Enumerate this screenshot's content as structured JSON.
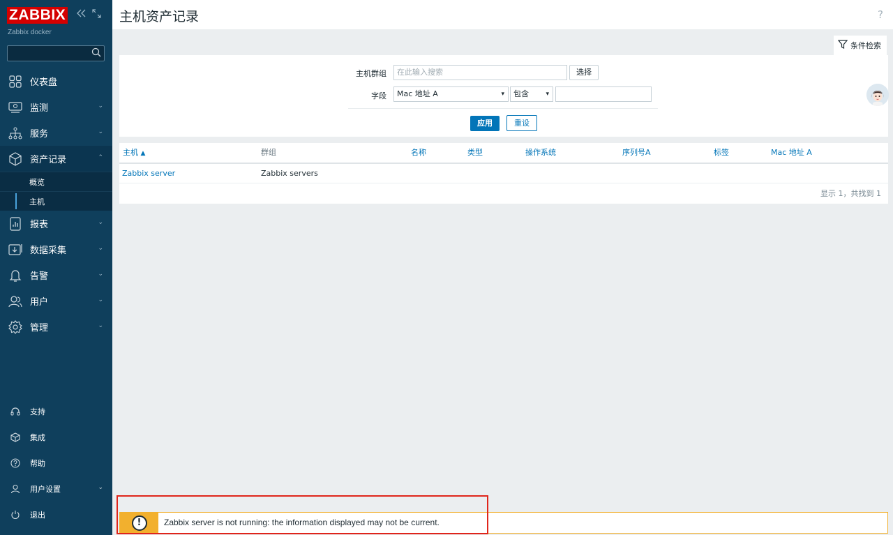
{
  "sidebar": {
    "logo": "ZABBIX",
    "subtitle": "Zabbix docker",
    "collapse_icon": "collapse-icon",
    "kiosk_icon": "kiosk-icon",
    "search_placeholder": "",
    "menu": [
      {
        "label": "仪表盘",
        "icon": "dashboard-icon",
        "expandable": false
      },
      {
        "label": "监测",
        "icon": "monitoring-icon",
        "expandable": true
      },
      {
        "label": "服务",
        "icon": "services-icon",
        "expandable": true
      },
      {
        "label": "资产记录",
        "icon": "inventory-icon",
        "expandable": true,
        "expanded": true
      },
      {
        "label": "报表",
        "icon": "reports-icon",
        "expandable": true
      },
      {
        "label": "数据采集",
        "icon": "data-collection-icon",
        "expandable": true
      },
      {
        "label": "告警",
        "icon": "alerts-icon",
        "expandable": true
      },
      {
        "label": "用户",
        "icon": "users-icon",
        "expandable": true
      },
      {
        "label": "管理",
        "icon": "administration-icon",
        "expandable": true
      }
    ],
    "submenu": [
      {
        "label": "概览",
        "selected": false
      },
      {
        "label": "主机",
        "selected": true
      }
    ],
    "bottom_menu": [
      {
        "label": "支持",
        "icon": "support-icon"
      },
      {
        "label": "集成",
        "icon": "integrations-icon"
      },
      {
        "label": "帮助",
        "icon": "help-icon"
      },
      {
        "label": "用户设置",
        "icon": "user-settings-icon"
      },
      {
        "label": "退出",
        "icon": "signout-icon"
      }
    ]
  },
  "header": {
    "title": "主机资产记录",
    "help": "?"
  },
  "filter": {
    "tab_label": "条件检索",
    "host_group_label": "主机群组",
    "host_group_placeholder": "在此输入搜索",
    "select_button": "选择",
    "field_label": "字段",
    "field_value": "Mac 地址 A",
    "operator_value": "包含",
    "search_value": "",
    "apply_button": "应用",
    "reset_button": "重设"
  },
  "table": {
    "columns": [
      {
        "label": "主机",
        "sorted": true,
        "sort_indicator": "▲"
      },
      {
        "label": "群组",
        "sorted": false
      },
      {
        "label": "名称",
        "sorted": false
      },
      {
        "label": "类型",
        "sorted": false
      },
      {
        "label": "操作系统",
        "sorted": false
      },
      {
        "label": "序列号A",
        "sorted": false
      },
      {
        "label": "标签",
        "sorted": false
      },
      {
        "label": "Mac 地址 A",
        "sorted": false
      }
    ],
    "rows": [
      {
        "host": "Zabbix server",
        "group": "Zabbix servers"
      }
    ],
    "paging": "显示 1，共找到 1"
  },
  "warning": {
    "icon": "!",
    "text": "Zabbix server is not running: the information displayed may not be current."
  },
  "colors": {
    "sidebar": "#0f3f5c",
    "accent": "#0275b8",
    "warning": "#f2b02e",
    "highlight_box": "#e0251b"
  }
}
